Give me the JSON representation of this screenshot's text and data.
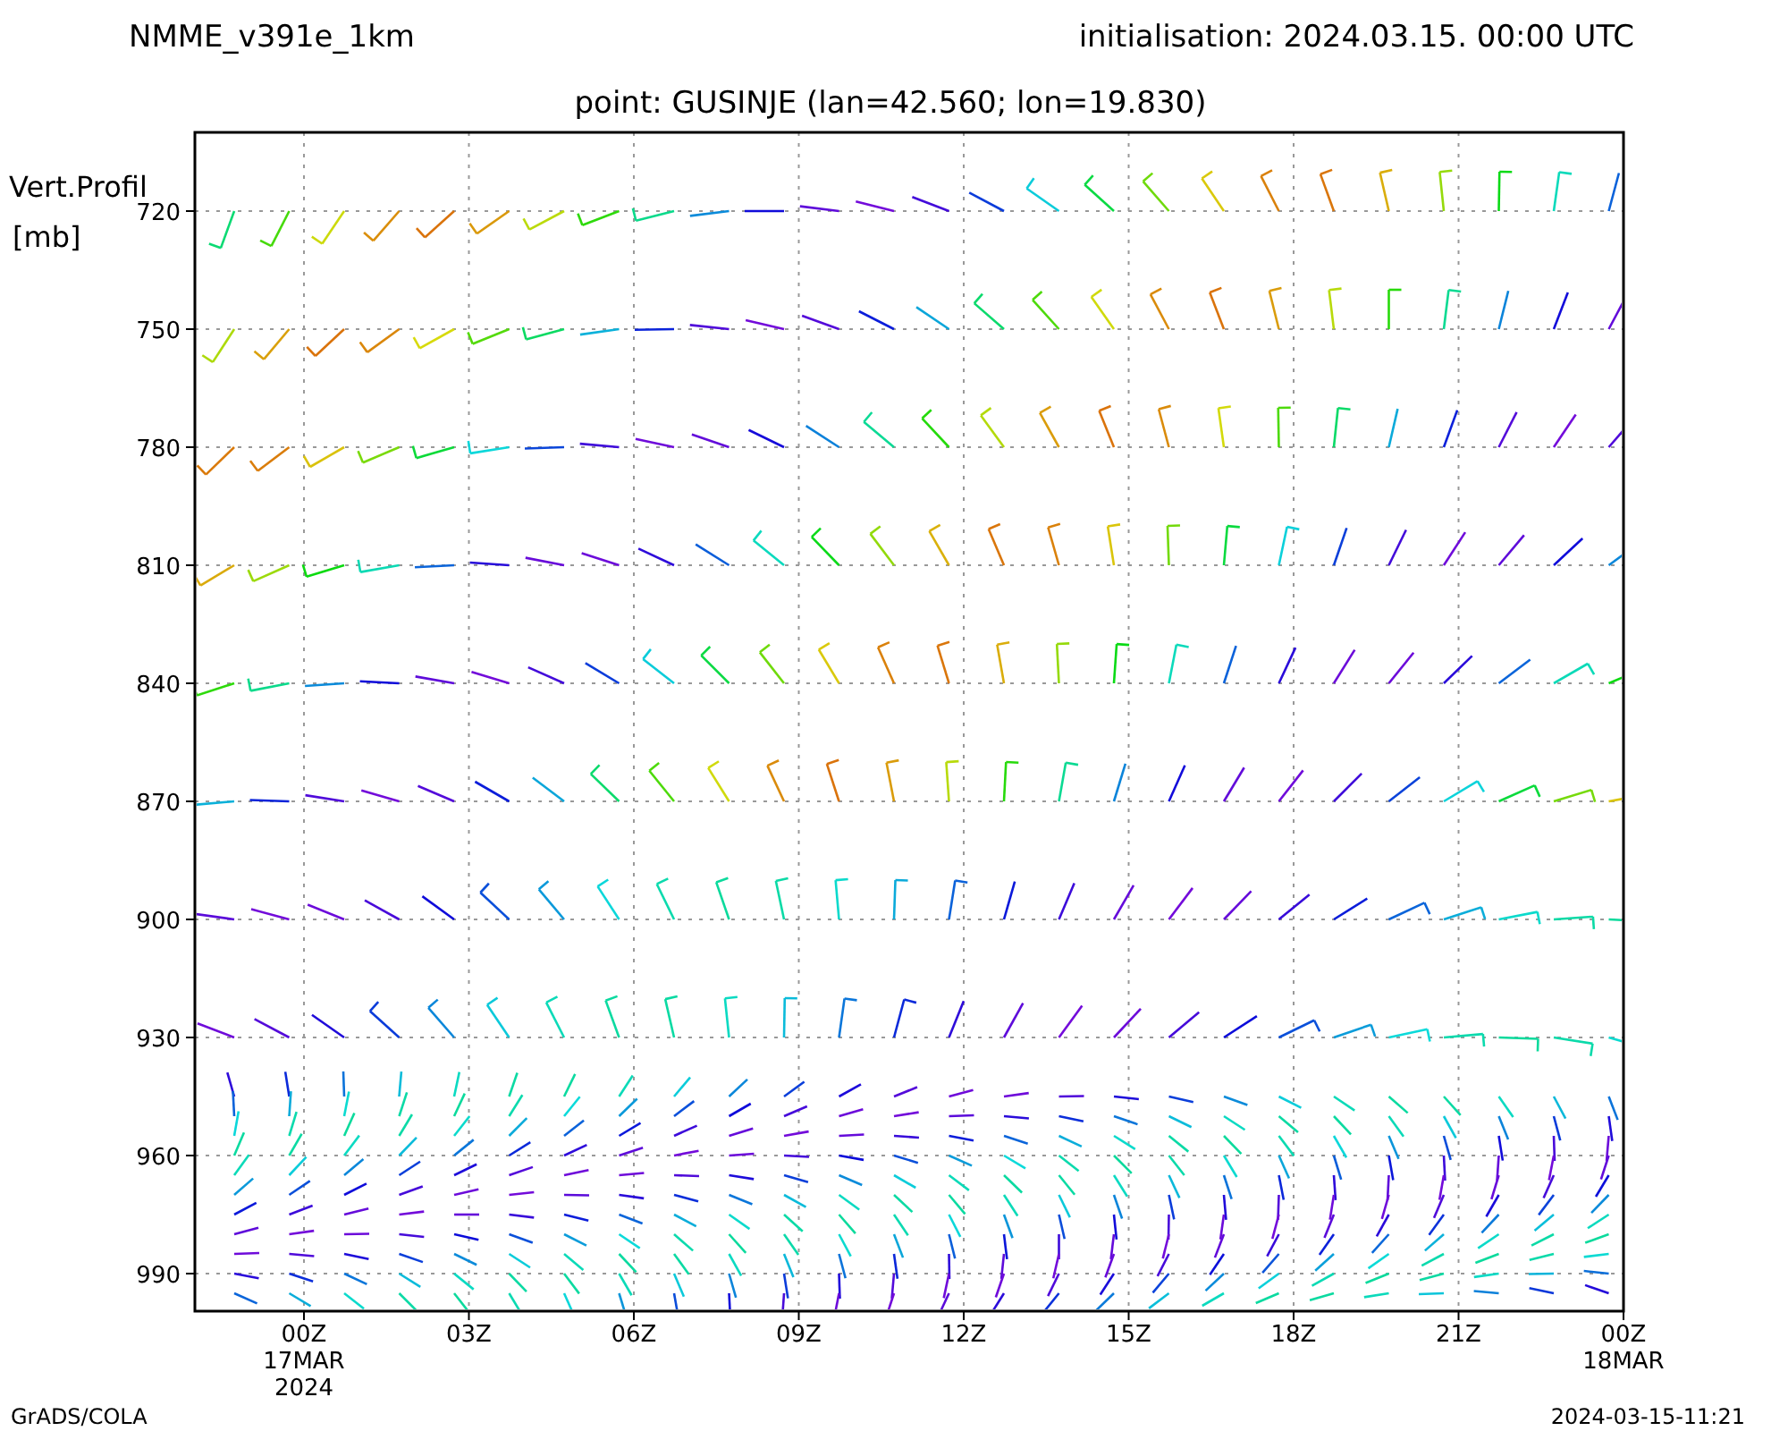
{
  "header": {
    "model": "NMME_v391e_1km",
    "initialisation": "initialisation: 2024.03.15. 00:00 UTC",
    "point": "point: GUSINJE (lan=42.560; lon=19.830)"
  },
  "y_axis": {
    "title_lines": [
      "Vert.Profil",
      "[mb]"
    ],
    "ticks": [
      "720",
      "750",
      "780",
      "810",
      "840",
      "870",
      "900",
      "930",
      "960",
      "990"
    ]
  },
  "x_axis": {
    "ticks": [
      {
        "label": "00Z",
        "date": "17MAR",
        "year": "2024"
      },
      {
        "label": "03Z"
      },
      {
        "label": "06Z"
      },
      {
        "label": "09Z"
      },
      {
        "label": "12Z"
      },
      {
        "label": "15Z"
      },
      {
        "label": "18Z"
      },
      {
        "label": "21Z"
      },
      {
        "label": "00Z",
        "date": "18MAR"
      }
    ]
  },
  "footer": {
    "left": "GrADS/COLA",
    "right": "2024-03-15-11:21"
  }
}
